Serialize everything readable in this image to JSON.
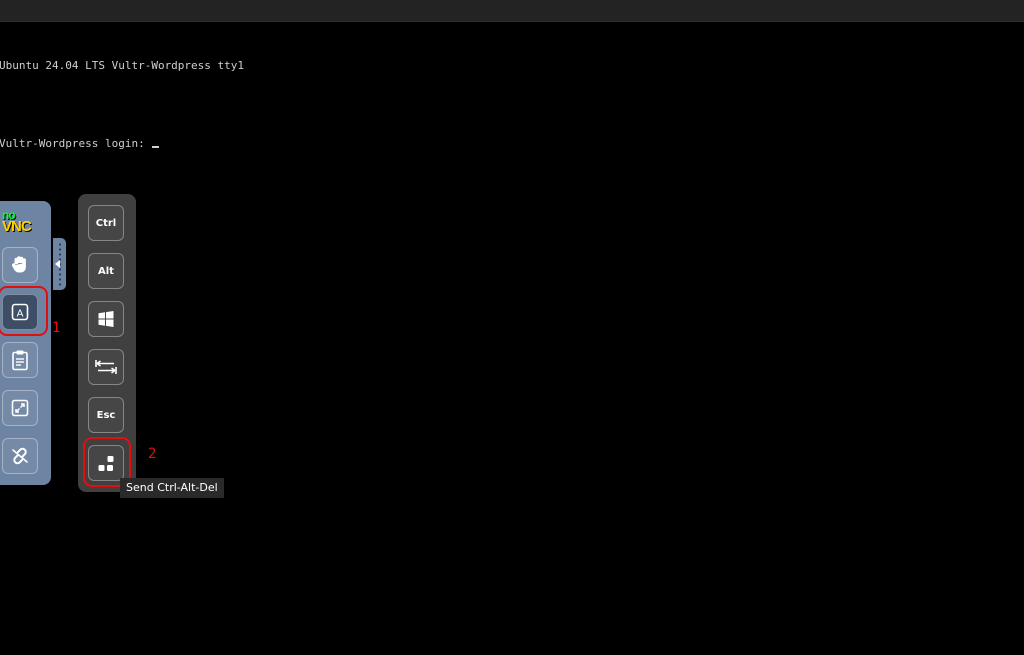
{
  "terminal": {
    "line1": "Ubuntu 24.04 LTS Vultr-Wordpress tty1",
    "line2": "Vultr-Wordpress login: "
  },
  "control_bar": {
    "logo_top": "no",
    "logo_bottom": "VNC",
    "buttons": [
      {
        "icon": "drag-hand-icon"
      },
      {
        "icon": "extra-keys-icon",
        "label": "A",
        "active": true
      },
      {
        "icon": "clipboard-icon"
      },
      {
        "icon": "fullscreen-icon"
      },
      {
        "icon": "disconnect-icon"
      }
    ]
  },
  "extra_keys": {
    "ctrl": "Ctrl",
    "alt": "Alt",
    "windows": "windows-icon",
    "tab": "tab-icon",
    "esc": "Esc",
    "ctrl_alt_del": "ctrl-alt-del-icon"
  },
  "annotations": {
    "step1": "1",
    "step2": "2"
  },
  "tooltip": {
    "text": "Send Ctrl-Alt-Del"
  },
  "colors": {
    "background": "#000000",
    "control_bar": "#6e84a3",
    "keys_panel": "#404040",
    "highlight": "#e01010",
    "logo_no": "#00ff3c",
    "logo_vnc": "#ffd200"
  }
}
